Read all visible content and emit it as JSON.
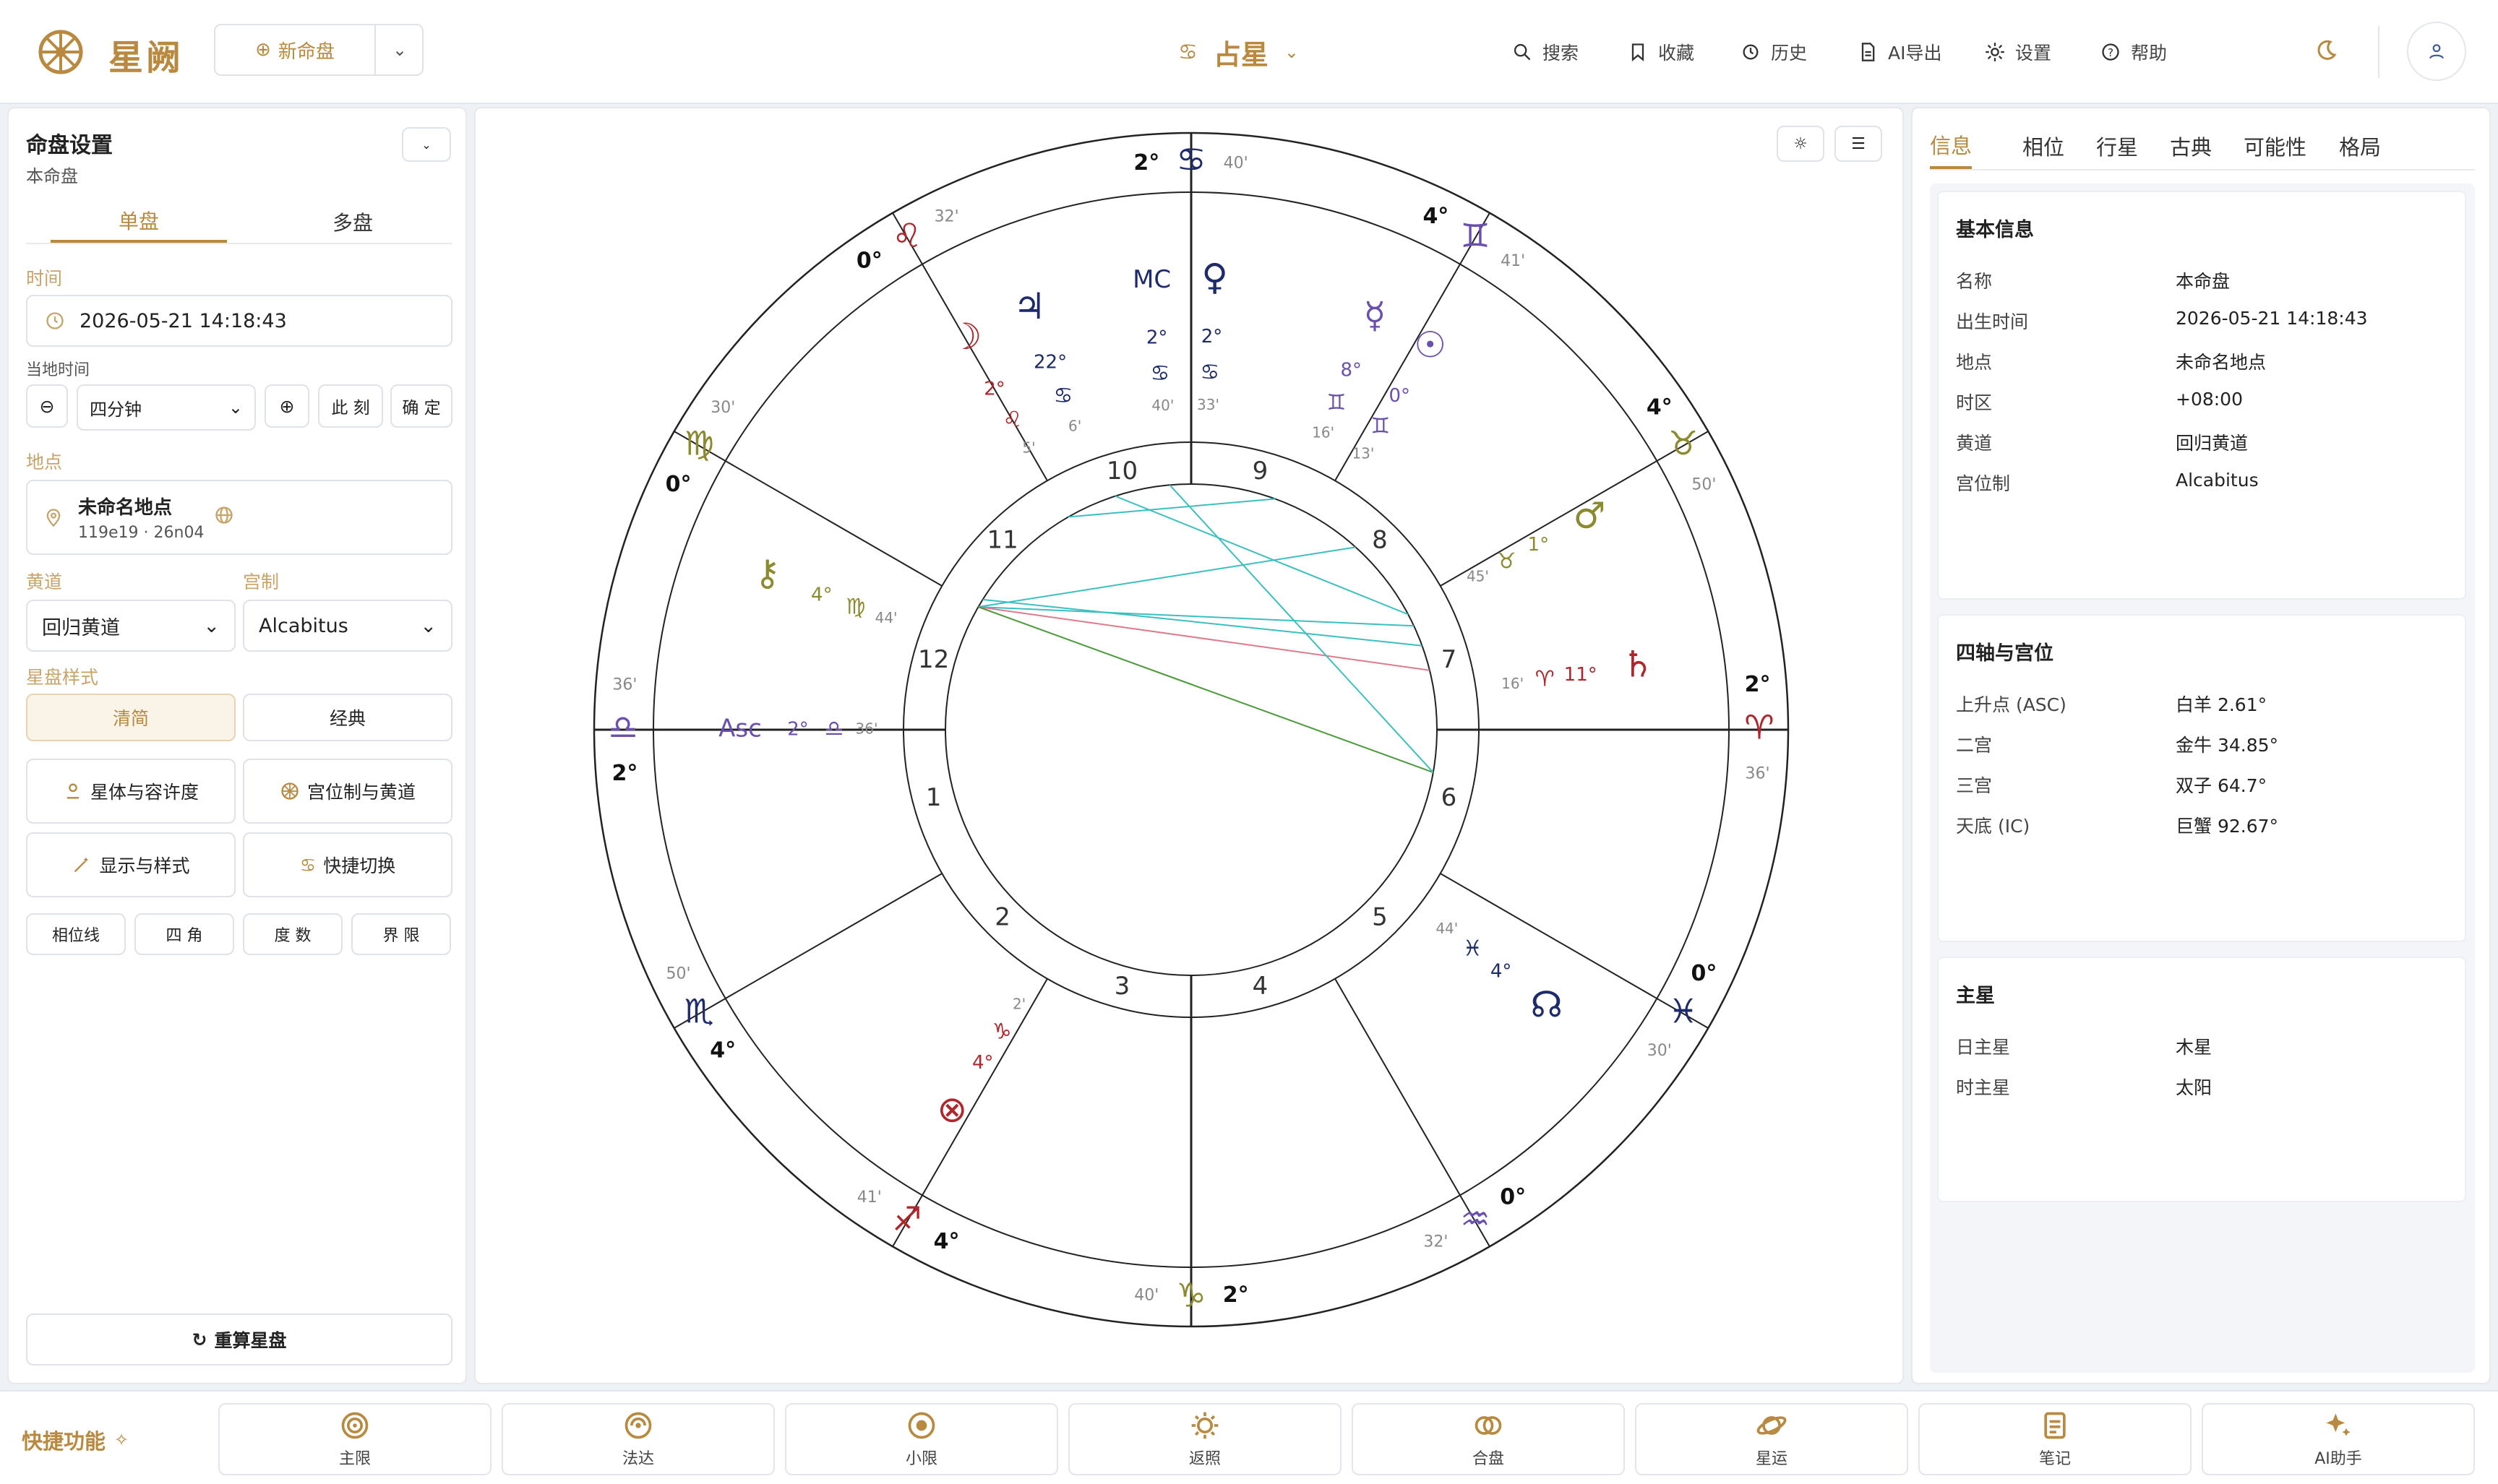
{
  "app": {
    "name": "星阙",
    "new_chart_label": "新命盘",
    "module_title": "占星"
  },
  "nav": [
    {
      "label": "搜索",
      "icon": "search-icon"
    },
    {
      "label": "收藏",
      "icon": "bookmark-icon"
    },
    {
      "label": "历史",
      "icon": "history-icon"
    },
    {
      "label": "AI导出",
      "icon": "document-icon"
    },
    {
      "label": "设置",
      "icon": "gear-icon"
    },
    {
      "label": "帮助",
      "icon": "help-icon"
    }
  ],
  "left": {
    "title": "命盘设置",
    "subtitle": "本命盘",
    "tabs": [
      "单盘",
      "多盘"
    ],
    "time_label": "时间",
    "datetime": "2026-05-21 14:18:43",
    "local_time_label": "当地时间",
    "step": "四分钟",
    "now_label": "此 刻",
    "ok_label": "确 定",
    "location_label": "地点",
    "location_name": "未命名地点",
    "location_coords": "119e19 · 26n04",
    "ecliptic_label": "黄道",
    "ecliptic_value": "回归黄道",
    "house_label": "宫制",
    "house_value": "Alcabitus",
    "style_label": "星盘样式",
    "style_options": [
      "清简",
      "经典"
    ],
    "actions": [
      "星体与容许度",
      "宫位制与黄道",
      "显示与样式",
      "快捷切换"
    ],
    "toggles": [
      "相位线",
      "四 角",
      "度 数",
      "界 限"
    ],
    "recalc_label": "重算星盘"
  },
  "chart_data": {
    "type": "astrology-wheel",
    "house_numbers": [
      "1",
      "2",
      "3",
      "4",
      "5",
      "6",
      "7",
      "8",
      "9",
      "10",
      "11",
      "12"
    ],
    "sign_cusps": [
      {
        "deg": "2°",
        "min": "40'",
        "sign": "♋"
      },
      {
        "deg": "4°",
        "min": "41'",
        "sign": "♊"
      },
      {
        "deg": "4°",
        "min": "50'",
        "sign": "♉"
      },
      {
        "deg": "2°",
        "min": "36'",
        "sign": "♈"
      },
      {
        "deg": "0°",
        "min": "30'",
        "sign": "♓"
      },
      {
        "deg": "0°",
        "min": "32'",
        "sign": "♒"
      },
      {
        "deg": "2°",
        "min": "40'",
        "sign": "♑"
      },
      {
        "deg": "4°",
        "min": "41'",
        "sign": "♐"
      },
      {
        "deg": "4°",
        "min": "50'",
        "sign": "♏"
      },
      {
        "deg": "2°",
        "min": "36'",
        "sign": "♎"
      },
      {
        "deg": "0°",
        "min": "30'",
        "sign": "♍"
      },
      {
        "deg": "0°",
        "min": "32'",
        "sign": "♌"
      }
    ],
    "planets": [
      {
        "glyph": "♀",
        "deg": "2°",
        "sign": "♋",
        "min": "33'"
      },
      {
        "glyph": "MC",
        "deg": "2°",
        "sign": "♋",
        "min": "40'"
      },
      {
        "glyph": "♃",
        "deg": "22°",
        "sign": "♋",
        "min": "6'"
      },
      {
        "glyph": "☽",
        "deg": "2°",
        "sign": "♌",
        "min": "5'"
      },
      {
        "glyph": "☿",
        "deg": "8°",
        "sign": "♊",
        "min": "16'"
      },
      {
        "glyph": "☉",
        "deg": "0°",
        "sign": "♊",
        "min": "13'"
      },
      {
        "glyph": "♂",
        "deg": "1°",
        "sign": "♉",
        "min": "45'"
      },
      {
        "glyph": "♄",
        "deg": "11°",
        "sign": "♈",
        "min": "16'"
      },
      {
        "glyph": "☊",
        "deg": "4°",
        "sign": "♓",
        "min": "44'"
      },
      {
        "glyph": "⚷",
        "deg": "4°",
        "sign": "♍",
        "min": "44'"
      },
      {
        "glyph": "Asc",
        "deg": "2°",
        "sign": "♎",
        "min": "36'"
      },
      {
        "glyph": "⊗",
        "deg": "4°",
        "sign": "♑",
        "min": "2'"
      }
    ]
  },
  "right": {
    "tabs": [
      "信息",
      "相位",
      "行星",
      "古典",
      "可能性",
      "格局"
    ],
    "basic": {
      "title": "基本信息",
      "rows": [
        {
          "k": "名称",
          "v": "本命盘"
        },
        {
          "k": "出生时间",
          "v": "2026-05-21 14:18:43"
        },
        {
          "k": "地点",
          "v": "未命名地点"
        },
        {
          "k": "时区",
          "v": "+08:00"
        },
        {
          "k": "黄道",
          "v": "回归黄道"
        },
        {
          "k": "宫位制",
          "v": "Alcabitus"
        }
      ]
    },
    "axes": {
      "title": "四轴与宫位",
      "rows": [
        {
          "k": "上升点 (ASC)",
          "v": "白羊 2.61°"
        },
        {
          "k": "二宫",
          "v": "金牛 34.85°"
        },
        {
          "k": "三宫",
          "v": "双子 64.7°"
        },
        {
          "k": "天底 (IC)",
          "v": "巨蟹 92.67°"
        }
      ]
    },
    "rulers": {
      "title": "主星",
      "rows": [
        {
          "k": "日主星",
          "v": "木星"
        },
        {
          "k": "时主星",
          "v": "太阳"
        }
      ]
    }
  },
  "bottom": {
    "title": "快捷功能",
    "items": [
      "主限",
      "法达",
      "小限",
      "返照",
      "合盘",
      "星运",
      "笔记",
      "AI助手"
    ]
  },
  "colors": {
    "accent": "#b8893e",
    "border": "#dfe2e6",
    "navy": "#1d2a6b",
    "purple": "#6a4fb0",
    "red": "#b0262a",
    "olive": "#8b8a2e"
  }
}
